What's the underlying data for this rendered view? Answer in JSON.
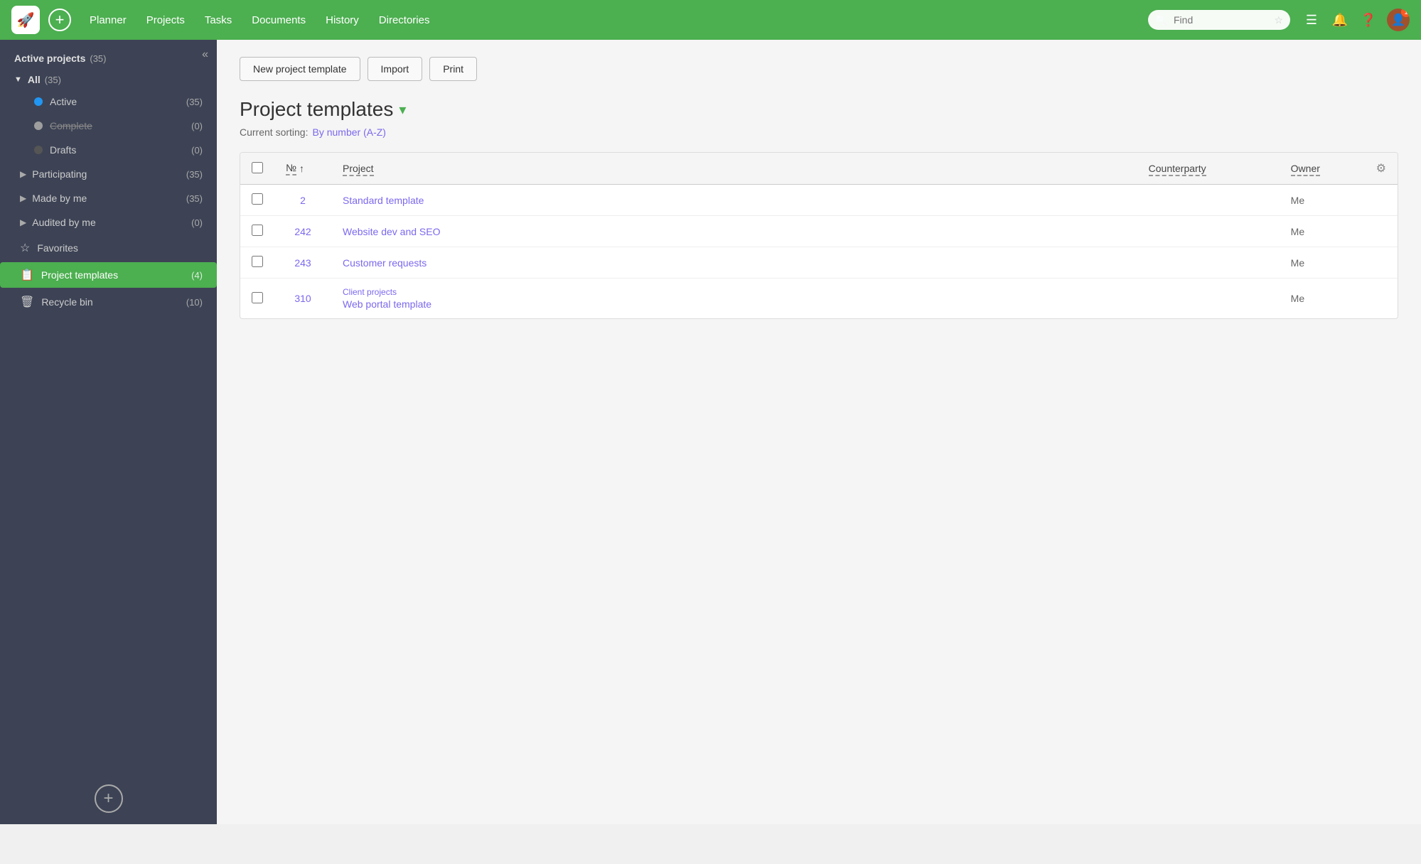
{
  "topnav": {
    "logo": "🚀",
    "add_label": "+",
    "links": [
      "Planner",
      "Projects",
      "Tasks",
      "Documents",
      "History",
      "Directories"
    ],
    "search_placeholder": "Find",
    "icons": {
      "menu": "☰",
      "bell": "🔔",
      "help": "❓"
    },
    "avatar_text": "👤",
    "avatar_badge": "1"
  },
  "sidebar": {
    "collapse_icon": "«",
    "section_title": "Active projects",
    "section_count": "(35)",
    "all_label": "All",
    "all_count": "(35)",
    "items": [
      {
        "id": "active",
        "label": "Active",
        "count": "(35)",
        "dot": "blue"
      },
      {
        "id": "complete",
        "label": "Complete",
        "count": "(0)",
        "dot": "gray",
        "strikethrough": true
      },
      {
        "id": "drafts",
        "label": "Drafts",
        "count": "(0)",
        "dot": "dark"
      }
    ],
    "nav_items": [
      {
        "id": "participating",
        "label": "Participating",
        "count": "(35)",
        "icon": "▶"
      },
      {
        "id": "made-by-me",
        "label": "Made by me",
        "count": "(35)",
        "icon": "▶"
      },
      {
        "id": "audited-by-me",
        "label": "Audited by me",
        "count": "(0)",
        "icon": "▶"
      },
      {
        "id": "favorites",
        "label": "Favorites",
        "icon": "☆",
        "type": "star"
      },
      {
        "id": "project-templates",
        "label": "Project templates",
        "count": "(4)",
        "icon": "📋",
        "active": true
      },
      {
        "id": "recycle-bin",
        "label": "Recycle bin",
        "count": "(10)",
        "icon": "🗑"
      }
    ],
    "add_btn": "+"
  },
  "main": {
    "toolbar": {
      "new_project_template": "New project template",
      "import": "Import",
      "print": "Print"
    },
    "page_title": "Project templates",
    "dropdown_arrow": "▾",
    "sort_label": "Current sorting:",
    "sort_value": "By number (A-Z)",
    "table": {
      "headers": {
        "num": "№",
        "sort_arrow": "↑",
        "project": "Project",
        "counterparty": "Counterparty",
        "owner": "Owner"
      },
      "rows": [
        {
          "num": "2",
          "project": "Standard template",
          "sub": "",
          "owner": "Me"
        },
        {
          "num": "242",
          "project": "Website dev and SEO",
          "sub": "",
          "owner": "Me"
        },
        {
          "num": "243",
          "project": "Customer requests",
          "sub": "",
          "owner": "Me"
        },
        {
          "num": "310",
          "project": "Web portal template",
          "sub": "Client projects",
          "owner": "Me"
        }
      ]
    }
  }
}
